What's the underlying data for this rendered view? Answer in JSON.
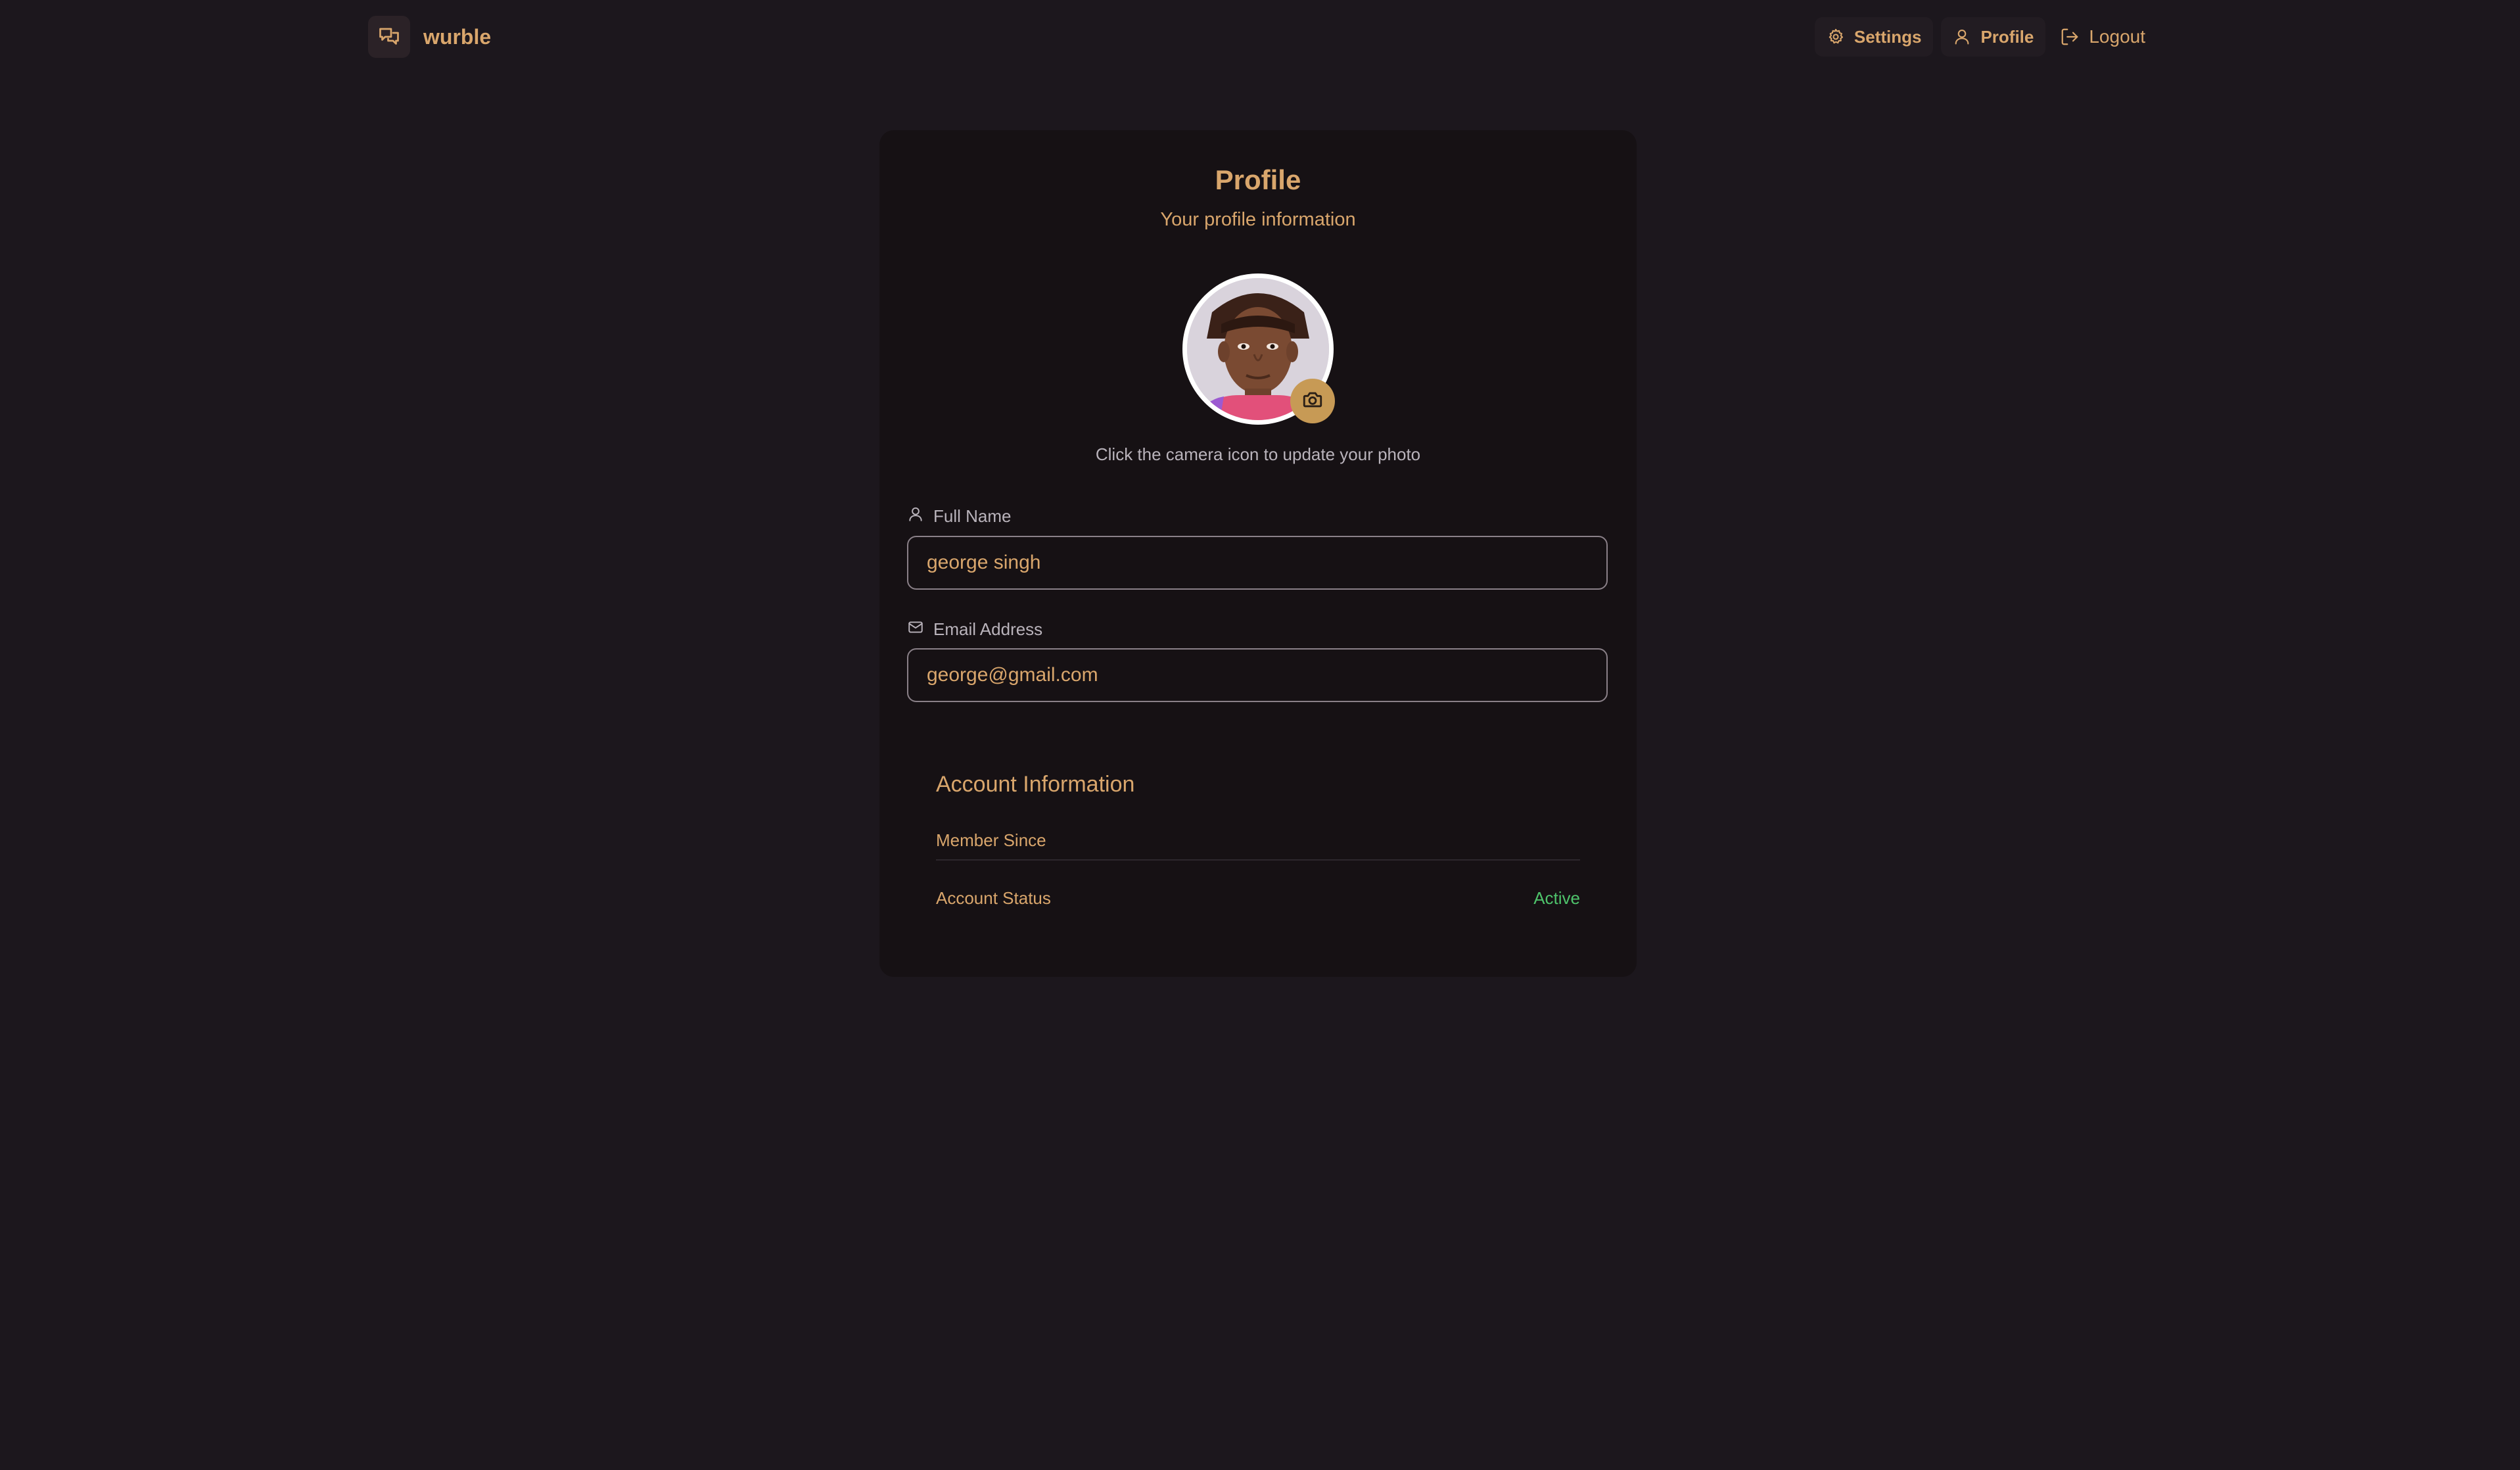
{
  "header": {
    "brand_name": "wurble",
    "nav": {
      "settings_label": "Settings",
      "profile_label": "Profile",
      "logout_label": "Logout"
    }
  },
  "profile": {
    "title": "Profile",
    "subtitle": "Your profile information",
    "avatar_hint": "Click the camera icon to update your photo",
    "full_name": {
      "label": "Full Name",
      "value": "george singh"
    },
    "email": {
      "label": "Email Address",
      "value": "george@gmail.com"
    }
  },
  "account_info": {
    "title": "Account Information",
    "member_since_label": "Member Since",
    "member_since_value": "",
    "status_label": "Account Status",
    "status_value": "Active"
  },
  "colors": {
    "background": "#1c171d",
    "card": "#161114",
    "accent": "#d9a66c",
    "status_active": "#4ec36b"
  },
  "icons": {
    "brand": "chat-bubbles-icon",
    "settings": "gear-icon",
    "profile": "user-icon",
    "logout": "logout-icon",
    "camera": "camera-icon",
    "name_field": "user-icon",
    "email_field": "mail-icon"
  }
}
